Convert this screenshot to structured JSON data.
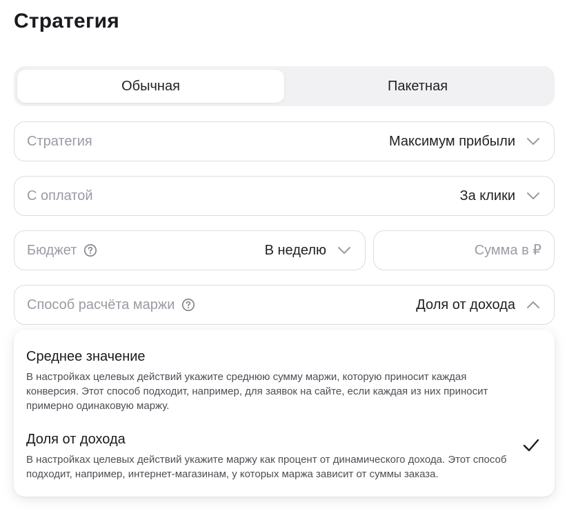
{
  "page_title": "Стратегия",
  "tabs": [
    {
      "label": "Обычная",
      "active": true
    },
    {
      "label": "Пакетная",
      "active": false
    }
  ],
  "strategy_field": {
    "label": "Стратегия",
    "value": "Максимум прибыли",
    "icon": "chevron-down-icon"
  },
  "payment_field": {
    "label": "С оплатой",
    "value": "За клики",
    "icon": "chevron-down-icon"
  },
  "budget_field": {
    "label": "Бюджет",
    "value": "В неделю",
    "help_icon": "question-circle-icon",
    "icon": "chevron-down-icon"
  },
  "sum_field": {
    "placeholder": "Сумма в ₽",
    "value": ""
  },
  "margin_field": {
    "label": "Способ расчёта маржи",
    "value": "Доля от дохода",
    "help_icon": "question-circle-icon",
    "icon": "chevron-up-icon"
  },
  "margin_options": [
    {
      "title": "Среднее значение",
      "description": "В настройках целевых действий укажите среднюю сумму маржи, которую приносит каждая конверсия. Этот способ подходит, например, для заявок на сайте, если каждая из них приносит примерно одинаковую маржу.",
      "selected": false
    },
    {
      "title": "Доля от дохода",
      "description": "В настройках целевых действий укажите маржу как процент от динамического дохода. Этот способ подходит, например, интернет-магазинам, у которых маржа зависит от суммы заказа.",
      "selected": true
    }
  ],
  "colors": {
    "text": "#1f1f24",
    "muted": "#9a9aa4",
    "border": "#dcdce2",
    "segment_bg": "#f1f1f4"
  }
}
